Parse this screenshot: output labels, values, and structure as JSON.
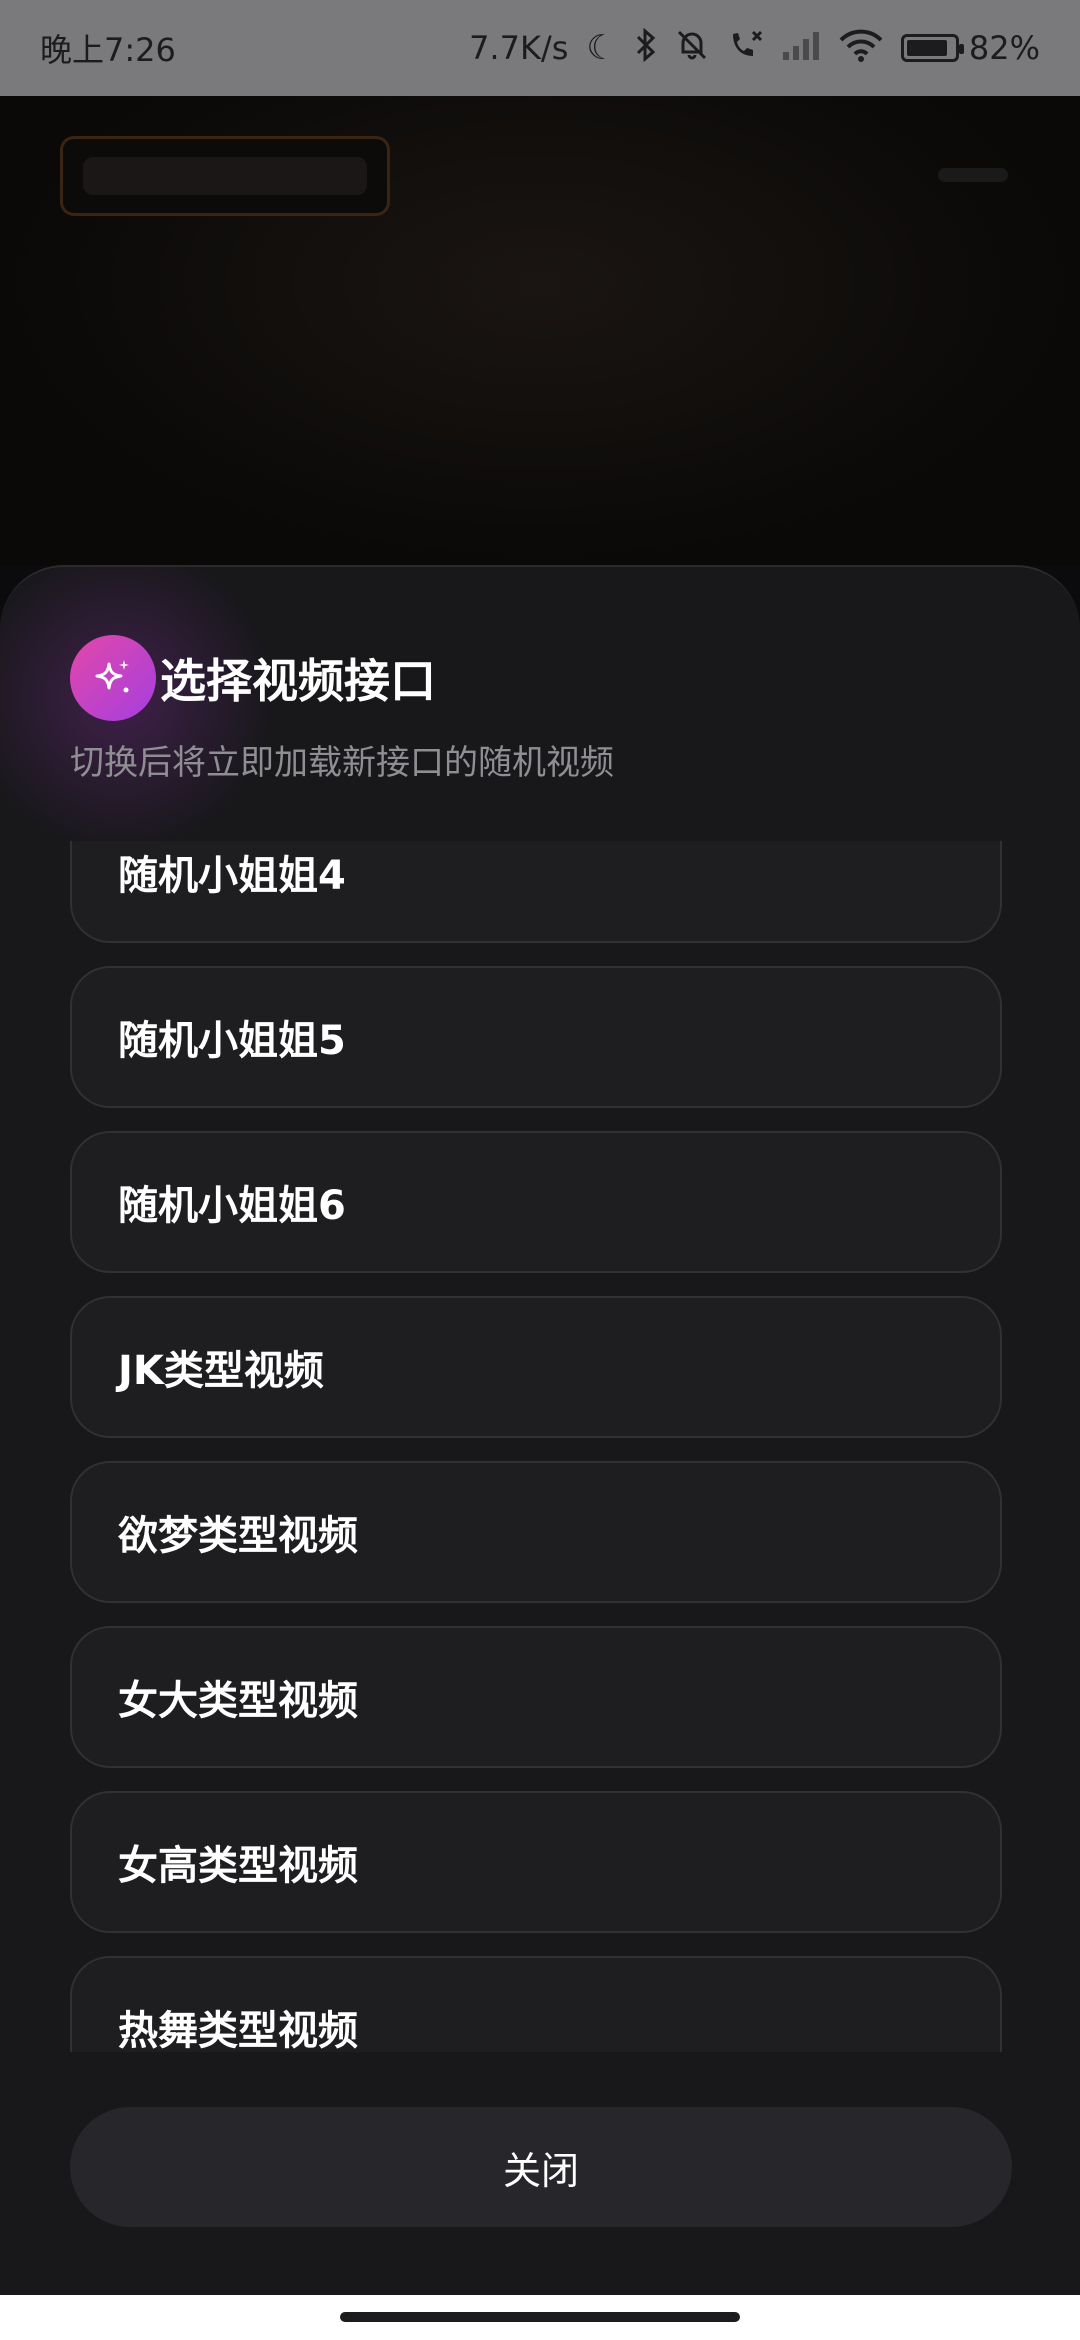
{
  "status_bar": {
    "time": "晚上7:26",
    "network_speed": "7.7K/s",
    "battery_percent": "82%",
    "battery_level": 0.82,
    "icons": [
      "moon-icon",
      "bluetooth-icon",
      "bell-muted-icon",
      "call-missed-icon",
      "signal-icon",
      "wifi-icon",
      "battery-icon"
    ]
  },
  "sheet": {
    "title": "选择视频接口",
    "subtitle": "切换后将立即加载新接口的随机视频",
    "items": [
      {
        "label": "随机小姐姐4"
      },
      {
        "label": "随机小姐姐5"
      },
      {
        "label": "随机小姐姐6"
      },
      {
        "label": "JK类型视频"
      },
      {
        "label": "欲梦类型视频"
      },
      {
        "label": "女大类型视频"
      },
      {
        "label": "女高类型视频"
      },
      {
        "label": "热舞类型视频"
      }
    ],
    "close_label": "关闭"
  },
  "colors": {
    "accent_gradient_start": "#e447a8",
    "accent_gradient_end": "#a43fe0"
  }
}
